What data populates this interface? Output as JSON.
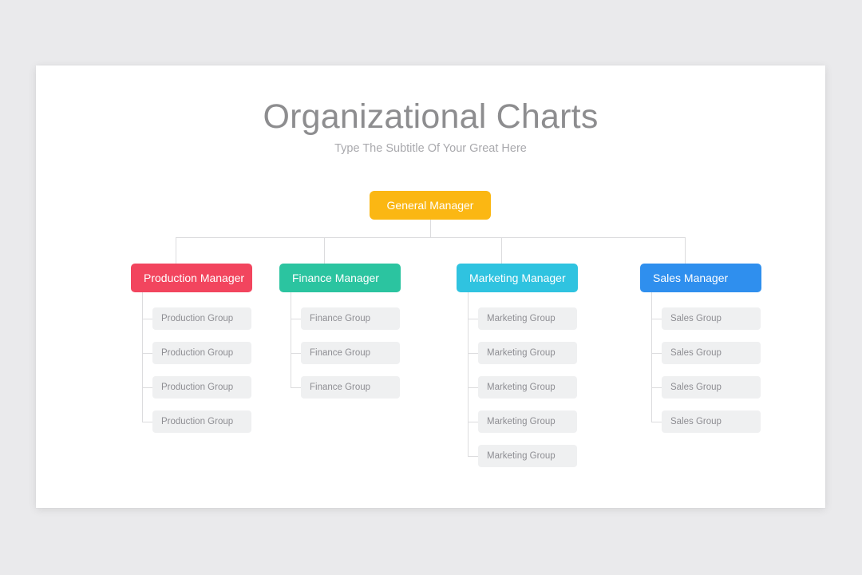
{
  "slide": {
    "title": "Organizational Charts",
    "subtitle": "Type The Subtitle Of Your Great Here",
    "background_color": "#eaeaec",
    "surface_color": "#ffffff",
    "title_color": "#8d8d8f",
    "subtitle_color": "#a9a9ad",
    "connector_color": "#dcdcde"
  },
  "chart_data": {
    "type": "diagram",
    "diagram_type": "organizational-chart",
    "title": "Organizational Charts",
    "subtitle": "Type The Subtitle Of Your Great Here",
    "orientation": "top-down",
    "root": {
      "label": "General Manager",
      "color": "#fbb713",
      "text_color": "#ffffff"
    },
    "branches": [
      {
        "label": "Production Manager",
        "color": "#f2455e",
        "text_color": "#ffffff",
        "child_label": "Production Group",
        "child_count": 4,
        "children": [
          "Production Group",
          "Production Group",
          "Production Group",
          "Production Group"
        ]
      },
      {
        "label": "Finance Manager",
        "color": "#2bc4a0",
        "text_color": "#ffffff",
        "child_label": "Finance Group",
        "child_count": 3,
        "children": [
          "Finance Group",
          "Finance Group",
          "Finance Group"
        ]
      },
      {
        "label": "Marketing Manager",
        "color": "#2fc3e0",
        "text_color": "#ffffff",
        "child_label": "Marketing Group",
        "child_count": 5,
        "children": [
          "Marketing Group",
          "Marketing Group",
          "Marketing Group",
          "Marketing Group",
          "Marketing Group"
        ]
      },
      {
        "label": "Sales Manager",
        "color": "#2f8fee",
        "text_color": "#ffffff",
        "child_label": "Sales Group",
        "child_count": 4,
        "children": [
          "Sales Group",
          "Sales Group",
          "Sales Group",
          "Sales Group"
        ]
      }
    ],
    "child_box_color": "#eff0f1",
    "child_text_color": "#8e8e93",
    "total_branches": 4,
    "total_children": 16
  }
}
